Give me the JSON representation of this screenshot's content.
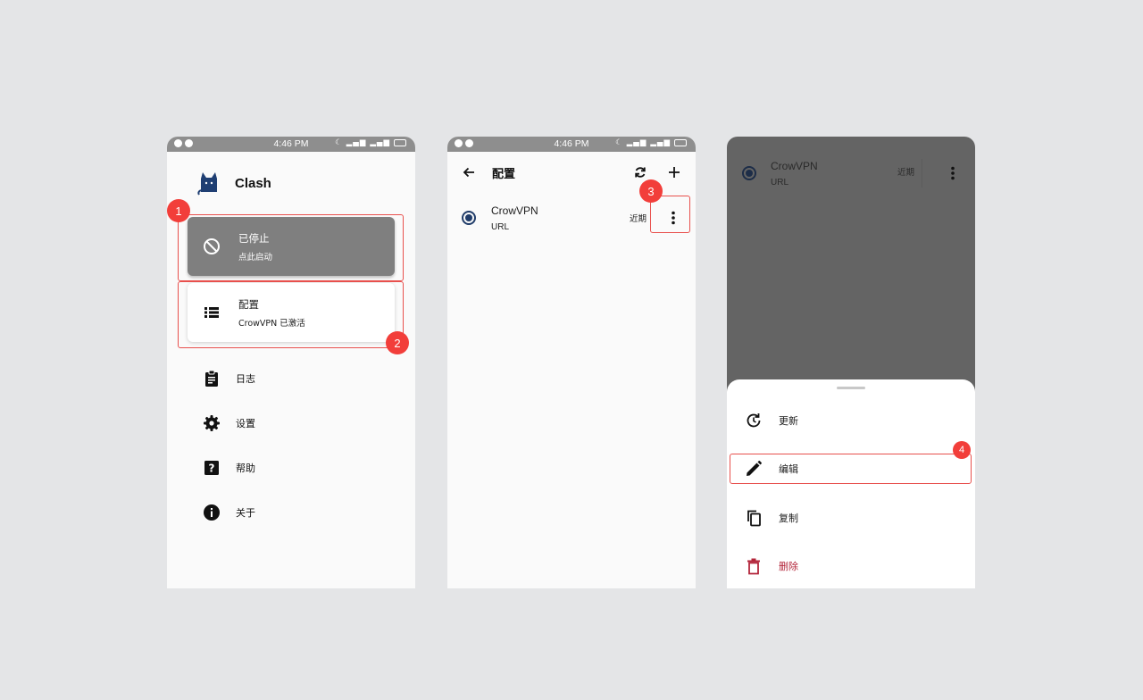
{
  "status_bar": {
    "time": "4:46 PM"
  },
  "screen1": {
    "app_name": "Clash",
    "status_card": {
      "title": "已停止",
      "subtitle": "点此启动"
    },
    "profile_card": {
      "title": "配置",
      "subtitle": "CrowVPN 已激活"
    },
    "menu": [
      {
        "label": "日志",
        "icon": "clipboard-icon"
      },
      {
        "label": "设置",
        "icon": "gear-icon"
      },
      {
        "label": "帮助",
        "icon": "help-icon"
      },
      {
        "label": "关于",
        "icon": "info-icon"
      }
    ]
  },
  "screen2": {
    "title": "配置",
    "profile": {
      "name": "CrowVPN",
      "type": "URL",
      "updated": "近期"
    }
  },
  "screen3": {
    "profile": {
      "name": "CrowVPN",
      "type": "URL",
      "updated": "近期"
    },
    "sheet": [
      {
        "label": "更新",
        "icon": "refresh-clock-icon"
      },
      {
        "label": "编辑",
        "icon": "pencil-icon"
      },
      {
        "label": "复制",
        "icon": "copy-icon"
      },
      {
        "label": "删除",
        "icon": "trash-icon"
      }
    ]
  },
  "annotations": {
    "step1": "1",
    "step2": "2",
    "step3": "3",
    "step4": "4"
  },
  "colors": {
    "accent": "#f23e3a",
    "radio": "#203c69",
    "danger": "#b3253a",
    "stopped_card": "#7f7f7f"
  }
}
